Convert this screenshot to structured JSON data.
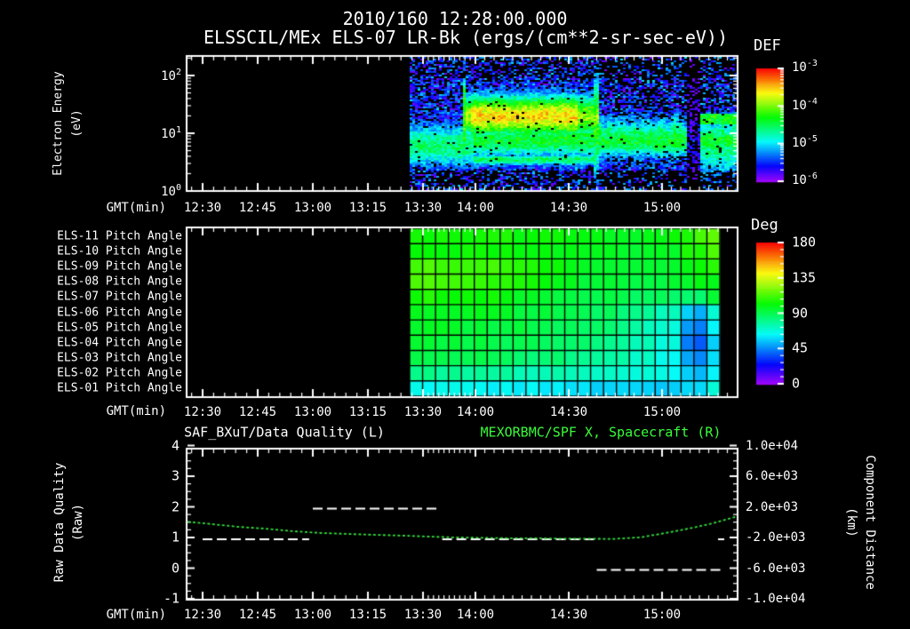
{
  "header": {
    "datetime": "2010/160 12:28:00.000",
    "title": "ELSSCIL/MEx ELS-07 LR-Bk  (ergs/(cm**2-sr-sec-eV))"
  },
  "time_axis": {
    "label": "GMT(min)",
    "tick_labels": [
      "12:30",
      "12:45",
      "13:00",
      "13:15",
      "13:30",
      "14:00",
      "14:30",
      "15:00"
    ]
  },
  "panel1": {
    "ylabel_line1": "Electron Energy",
    "ylabel_line2": "(eV)",
    "ytick_labels": [
      {
        "base": "10",
        "exp": "2"
      },
      {
        "base": "10",
        "exp": "1"
      },
      {
        "base": "10",
        "exp": "0"
      }
    ],
    "colorbar_title": "DEF",
    "colorbar_ticks": [
      {
        "base": "10",
        "exp": "-3"
      },
      {
        "base": "10",
        "exp": "-4"
      },
      {
        "base": "10",
        "exp": "-5"
      },
      {
        "base": "10",
        "exp": "-6"
      }
    ]
  },
  "panel2": {
    "row_labels": [
      "ELS-11 Pitch Angle",
      "ELS-10 Pitch Angle",
      "ELS-09 Pitch Angle",
      "ELS-08 Pitch Angle",
      "ELS-07 Pitch Angle",
      "ELS-06 Pitch Angle",
      "ELS-05 Pitch Angle",
      "ELS-04 Pitch Angle",
      "ELS-03 Pitch Angle",
      "ELS-02 Pitch Angle",
      "ELS-01 Pitch Angle"
    ],
    "colorbar_title": "Deg",
    "colorbar_ticks": [
      "180",
      "135",
      "90",
      "45",
      "0"
    ]
  },
  "panel3": {
    "title_left": "SAF_BXuT/Data Quality (L)",
    "title_right": "MEXORBMC/SPF X, Spacecraft (R)",
    "ylabel_left_line1": "Raw Data Quality",
    "ylabel_left_line2": "(Raw)",
    "ylabel_right_line1": "Component Distance",
    "ylabel_right_line2": "(km)",
    "ytick_labels_left": [
      "4",
      "3",
      "2",
      "1",
      "0",
      "-1"
    ],
    "ytick_labels_right": [
      "1.0e+04",
      "6.0e+03",
      "2.0e+03",
      "-2.0e+03",
      "-6.0e+03",
      "-1.0e+04"
    ]
  },
  "colors": {
    "background": "#000000",
    "text": "#ffffff",
    "title_right_green": "#3afc3a",
    "curve_green": "#32e03c",
    "quality_dash_white": "#ffffff"
  },
  "chart_data": [
    {
      "type": "heatmap",
      "panel": "electron-energy-spectrogram",
      "title": "ELSSCIL/MEx ELS-07 LR-Bk",
      "units": "ergs/(cm**2-sr-sec-eV)",
      "xlabel": "GMT(min)",
      "ylabel": "Electron Energy (eV)",
      "x_range": [
        "12:25",
        "15:25"
      ],
      "y_scale": "log",
      "y_range_eV": [
        1,
        218
      ],
      "colorbar": {
        "title": "DEF",
        "scale": "log",
        "range": [
          1e-06,
          0.001
        ]
      },
      "data_start": "13:26",
      "features": [
        {
          "time": [
            "13:26",
            "15:24"
          ],
          "energy_eV": [
            5,
            12
          ],
          "flux": 3e-05,
          "desc": "continuous cyan-green band"
        },
        {
          "time": [
            "13:29",
            "13:31"
          ],
          "energy_eV": [
            8,
            100
          ],
          "flux": 0.0001,
          "desc": "vertical enhancement spike"
        },
        {
          "time": [
            "13:33",
            "14:05"
          ],
          "energy_eV": [
            12,
            60
          ],
          "flux": 0.00025,
          "desc": "bright yellow-green burst, peak near 20-40 eV"
        },
        {
          "time": [
            "13:35",
            "14:04"
          ],
          "energy_eV": [
            3,
            4.5
          ],
          "flux": 3e-05,
          "desc": "thin low-energy band"
        },
        {
          "time": [
            "14:05",
            "14:07"
          ],
          "energy_eV": [
            8,
            100
          ],
          "flux": 8e-05,
          "desc": "vertical spike"
        },
        {
          "time": [
            "14:07",
            "14:49"
          ],
          "energy_eV": [
            5,
            15
          ],
          "flux": 2e-05,
          "desc": "moderate cyan band with vertical streaking"
        },
        {
          "time": [
            "14:49",
            "14:53"
          ],
          "energy_eV": [
            1,
            200
          ],
          "flux": 1e-06,
          "desc": "data dropout (dark vertical gap)"
        },
        {
          "time": [
            "14:54",
            "15:24"
          ],
          "energy_eV": [
            4,
            20
          ],
          "flux": 3e-05,
          "desc": "cyan patch with green line near 30 eV"
        },
        {
          "time": [
            "13:26",
            "15:24"
          ],
          "energy_eV": [
            1,
            218
          ],
          "flux": 2e-06,
          "desc": "blue/violet background noise speckle"
        }
      ]
    },
    {
      "type": "heatmap",
      "panel": "pitch-angle",
      "rows": [
        "ELS-11",
        "ELS-10",
        "ELS-09",
        "ELS-08",
        "ELS-07",
        "ELS-06",
        "ELS-05",
        "ELS-04",
        "ELS-03",
        "ELS-02",
        "ELS-01"
      ],
      "colorbar": {
        "title": "Deg",
        "range": [
          0,
          180
        ]
      },
      "x_range": [
        "13:26",
        "15:19"
      ],
      "columns": 24,
      "values_deg": [
        [
          105,
          105,
          104,
          104,
          105,
          103,
          104,
          105,
          103,
          104,
          102,
          103,
          101,
          100,
          101,
          100,
          100,
          99,
          100,
          100,
          101,
          108,
          114,
          118
        ],
        [
          104,
          104,
          103,
          104,
          103,
          104,
          102,
          103,
          102,
          102,
          101,
          100,
          99,
          99,
          98,
          98,
          97,
          97,
          98,
          98,
          99,
          104,
          108,
          112
        ],
        [
          112,
          113,
          112,
          111,
          112,
          110,
          111,
          110,
          108,
          106,
          104,
          102,
          100,
          98,
          97,
          96,
          95,
          95,
          94,
          95,
          96,
          100,
          104,
          108
        ],
        [
          113,
          114,
          113,
          112,
          113,
          112,
          110,
          109,
          107,
          105,
          103,
          100,
          98,
          96,
          95,
          94,
          93,
          92,
          92,
          93,
          94,
          96,
          98,
          100
        ],
        [
          106,
          106,
          105,
          105,
          104,
          104,
          103,
          101,
          99,
          97,
          96,
          95,
          94,
          93,
          92,
          91,
          90,
          89,
          88,
          87,
          86,
          84,
          85,
          95
        ],
        [
          100,
          100,
          99,
          99,
          98,
          98,
          97,
          96,
          95,
          94,
          93,
          92,
          91,
          90,
          89,
          87,
          85,
          82,
          78,
          75,
          72,
          55,
          50,
          70
        ],
        [
          97,
          97,
          96,
          96,
          95,
          95,
          94,
          93,
          92,
          91,
          90,
          89,
          88,
          87,
          85,
          83,
          80,
          77,
          74,
          71,
          68,
          48,
          42,
          62
        ],
        [
          95,
          95,
          94,
          94,
          93,
          93,
          92,
          91,
          90,
          89,
          88,
          87,
          86,
          85,
          83,
          81,
          78,
          75,
          72,
          69,
          66,
          45,
          40,
          58
        ],
        [
          92,
          92,
          91,
          91,
          90,
          90,
          89,
          88,
          87,
          86,
          85,
          84,
          83,
          82,
          80,
          78,
          76,
          73,
          70,
          68,
          66,
          48,
          45,
          60
        ],
        [
          80,
          80,
          79,
          79,
          78,
          78,
          77,
          76,
          76,
          75,
          74,
          74,
          73,
          72,
          71,
          70,
          69,
          68,
          67,
          66,
          65,
          58,
          55,
          65
        ],
        [
          66,
          66,
          65,
          65,
          64,
          64,
          63,
          63,
          62,
          62,
          61,
          61,
          60,
          60,
          59,
          59,
          58,
          58,
          57,
          57,
          56,
          58,
          60,
          68
        ]
      ]
    },
    {
      "type": "line",
      "panel": "quality-and-distance",
      "ylim_left": [
        -1,
        4
      ],
      "ylim_right": [
        -10000,
        10000
      ],
      "series": [
        {
          "name": "SAF_BXuT/Data Quality (L)",
          "axis": "left",
          "style": "white-dashed",
          "segments": [
            {
              "t": [
                "12:30",
                "12:59"
              ],
              "value": 1
            },
            {
              "t": [
                "13:00",
                "13:39"
              ],
              "value": 2
            },
            {
              "t": [
                "13:41",
                "14:39"
              ],
              "value": 1
            },
            {
              "t": [
                "14:39",
                "15:19"
              ],
              "value": 0
            },
            {
              "t": [
                "15:18",
                "15:20"
              ],
              "value": 1
            }
          ]
        },
        {
          "name": "MEXORBMC/SPF X, Spacecraft (R)",
          "axis": "right",
          "style": "green-dotted",
          "points": [
            [
              "12:26",
              60
            ],
            [
              "12:33",
              -280
            ],
            [
              "12:40",
              -620
            ],
            [
              "12:47",
              -850
            ],
            [
              "12:55",
              -1190
            ],
            [
              "13:02",
              -1410
            ],
            [
              "13:09",
              -1530
            ],
            [
              "13:16",
              -1640
            ],
            [
              "13:24",
              -1750
            ],
            [
              "13:32",
              -1870
            ],
            [
              "13:47",
              -1980
            ],
            [
              "14:01",
              -2040
            ],
            [
              "14:10",
              -2090
            ],
            [
              "14:19",
              -2090
            ],
            [
              "14:27",
              -2150
            ],
            [
              "14:36",
              -2150
            ],
            [
              "14:44",
              -2200
            ],
            [
              "14:53",
              -1980
            ],
            [
              "14:58",
              -1640
            ],
            [
              "15:04",
              -1190
            ],
            [
              "15:10",
              -730
            ],
            [
              "15:16",
              -170
            ],
            [
              "15:20",
              280
            ],
            [
              "15:24",
              730
            ]
          ]
        }
      ]
    }
  ]
}
